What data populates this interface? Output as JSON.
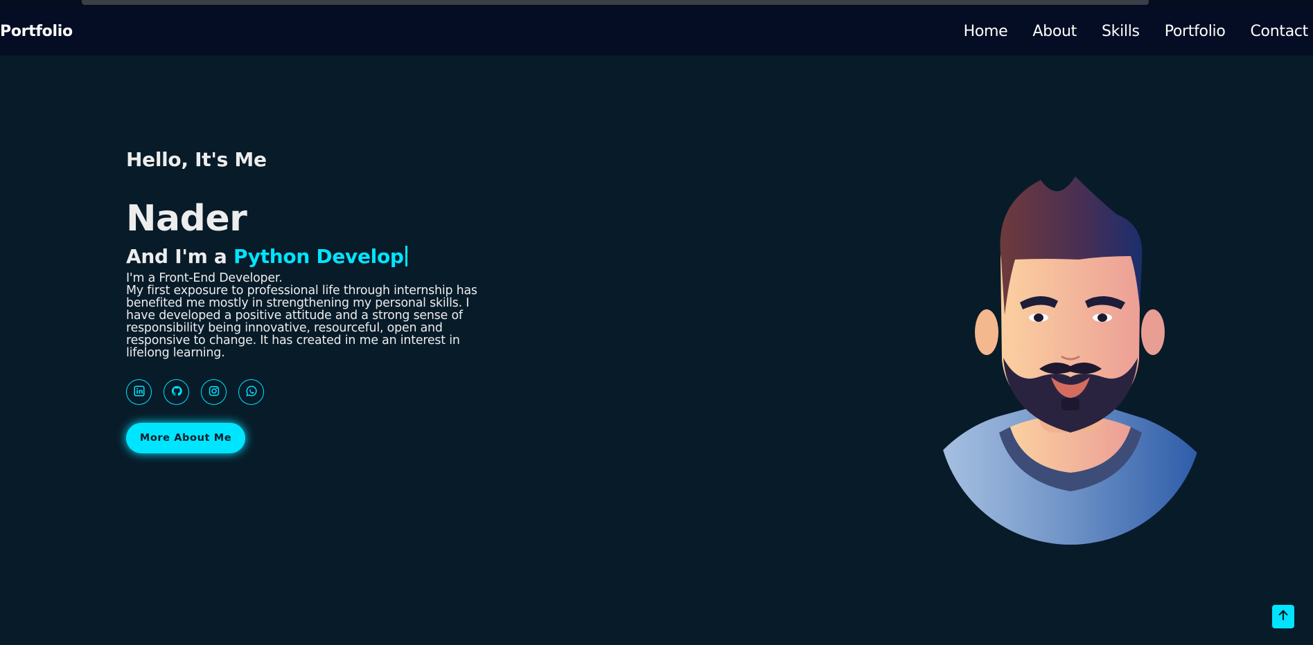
{
  "header": {
    "logo": "Portfolio",
    "nav": [
      "Home",
      "About",
      "Skills",
      "Portfolio",
      "Contact"
    ]
  },
  "hero": {
    "greeting": "Hello, It's Me",
    "name": "Nader",
    "role_prefix": "And I'm a",
    "role_typed": "Python Develop",
    "intro_line1": "I'm a Front-End Developer.",
    "intro_body": "My first exposure to professional life through internship has benefited me mostly in strengthening my personal skills. I have developed a positive attitude and a strong sense of responsibility being innovative, resourceful, open and responsive to change. It has created in me an interest in lifelong learning.",
    "socials": [
      "linkedin-icon",
      "github-icon",
      "instagram-icon",
      "whatsapp-icon"
    ],
    "button": "More About Me"
  },
  "scroll_top_icon": "arrow-up-icon",
  "colors": {
    "background": "#081b29",
    "header": "#050d24",
    "accent": "#00e5ff",
    "text": "#ededed"
  }
}
